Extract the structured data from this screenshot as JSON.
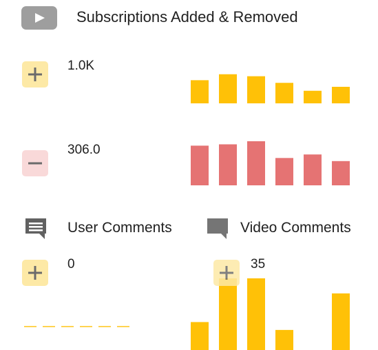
{
  "header": {
    "icon": "youtube-play-icon",
    "title": "Subscriptions Added & Removed"
  },
  "colors": {
    "accent_yellow": "#ffc107",
    "removed_red": "#e57373",
    "plus_badge_bg": "#fde9a6",
    "minus_badge_bg": "#f9d9d9",
    "icon_gray": "#9e9e9e"
  },
  "subs_added": {
    "icon": "plus-icon",
    "value": "1.0K",
    "bars": [
      0.7,
      0.88,
      0.82,
      0.62,
      0.38,
      0.5
    ]
  },
  "subs_removed": {
    "icon": "minus-icon",
    "value": "306.0",
    "bars": [
      0.9,
      0.93,
      1.0,
      0.62,
      0.7,
      0.55
    ]
  },
  "user_comments": {
    "icon": "comment-icon",
    "label": "User Comments",
    "sign_icon": "plus-icon",
    "value": "0",
    "bars": [
      0,
      0,
      0,
      0,
      0,
      0
    ]
  },
  "video_comments": {
    "icon": "comment-filled-icon",
    "label": "Video Comments",
    "sign_icon": "plus-icon",
    "value": "35",
    "bars": [
      0.39,
      1.0,
      1.0,
      0.28,
      0.0,
      0.79
    ]
  }
}
